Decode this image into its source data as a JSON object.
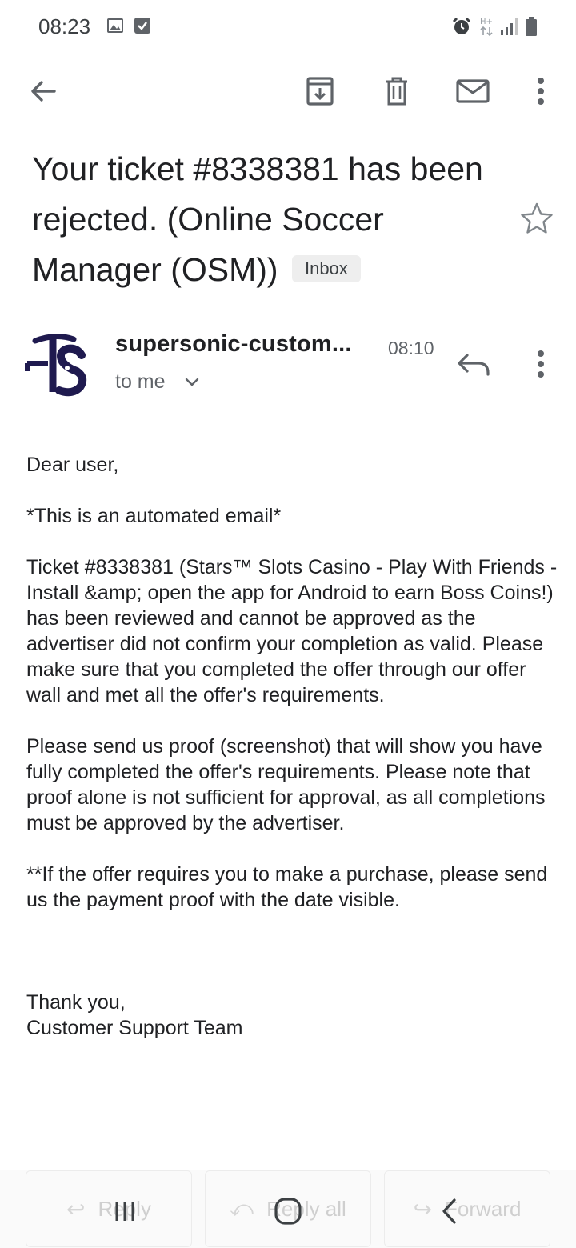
{
  "status_bar": {
    "time": "08:23",
    "left_icons": [
      "image-icon",
      "checkbox-icon"
    ],
    "right_icons": [
      "alarm-icon",
      "h-plus-network-icon",
      "signal-icon",
      "battery-icon"
    ]
  },
  "toolbar": {
    "icons": [
      "back-arrow-icon",
      "archive-icon",
      "delete-icon",
      "mark-unread-icon",
      "more-vert-icon"
    ]
  },
  "subject": {
    "text": "Your ticket #8338381 has been rejected. (Online Soccer Manager (OSM))",
    "label": "Inbox"
  },
  "sender": {
    "name": "supersonic-custom...",
    "time": "08:10",
    "recipient": "to me"
  },
  "body": {
    "greeting": "Dear user,",
    "automated": "*This is an automated email*",
    "paragraph1": "Ticket #8338381 (Stars™ Slots Casino - Play With Friends - Install &amp; open the app for Android to earn Boss Coins!) has been reviewed and cannot be approved as the advertiser did not confirm your completion as valid. Please make sure that you completed the offer through our offer wall and met all the offer's requirements.",
    "paragraph2": "Please send us proof (screenshot) that will show you have fully completed the offer's requirements. Please note that proof alone is not sufficient for approval, as all completions must be approved by the advertiser.",
    "paragraph3": "**If the offer requires you to make a purchase, please send us the payment proof with the date visible.",
    "closing": "Thank you,",
    "signature": "Customer Support Team"
  },
  "actions": {
    "reply": "Reply",
    "reply_all": "Reply all",
    "forward": "Forward"
  },
  "colors": {
    "text": "#202124",
    "secondary": "#5f6368",
    "avatar_navy": "#1f1a4f"
  }
}
